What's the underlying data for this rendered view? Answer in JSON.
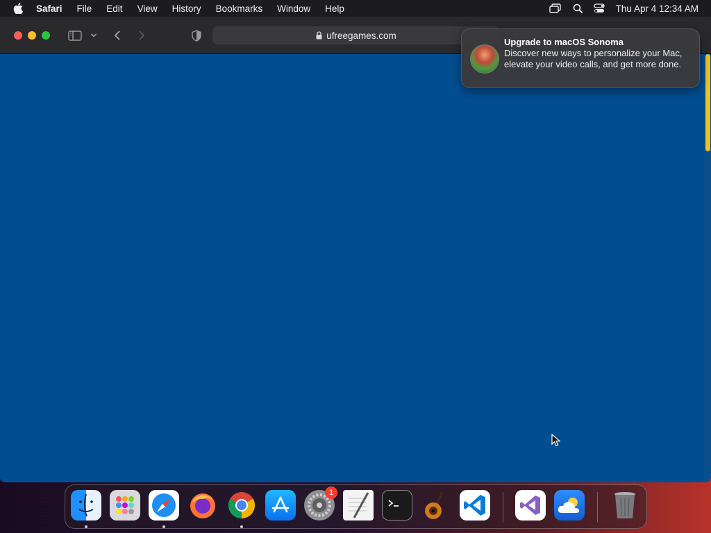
{
  "menubar": {
    "app_name": "Safari",
    "items": [
      "File",
      "Edit",
      "View",
      "History",
      "Bookmarks",
      "Window",
      "Help"
    ],
    "clock": "Thu Apr 4  12:34 AM"
  },
  "browser": {
    "url": "ufreegames.com",
    "page_background": "#004e92",
    "scrollbar_color": "#f3c21a"
  },
  "notification": {
    "title": "Upgrade to macOS Sonoma",
    "body": "Discover new ways to personalize your Mac, elevate your video calls, and get more done."
  },
  "dock": {
    "apps": [
      {
        "name": "Finder",
        "icon": "finder-icon",
        "running": true
      },
      {
        "name": "Launchpad",
        "icon": "launchpad-icon",
        "running": false
      },
      {
        "name": "Safari",
        "icon": "safari-icon",
        "running": true
      },
      {
        "name": "Firefox",
        "icon": "firefox-icon",
        "running": false
      },
      {
        "name": "Chrome",
        "icon": "chrome-icon",
        "running": true
      },
      {
        "name": "App Store",
        "icon": "app-store-icon",
        "running": false
      },
      {
        "name": "System Settings",
        "icon": "system-settings-icon",
        "running": false,
        "badge": "1"
      },
      {
        "name": "TextEdit",
        "icon": "textedit-icon",
        "running": false
      },
      {
        "name": "Terminal",
        "icon": "terminal-icon",
        "running": false
      },
      {
        "name": "GarageBand",
        "icon": "garageband-icon",
        "running": false
      },
      {
        "name": "Visual Studio Code",
        "icon": "vscode-icon",
        "running": false
      },
      {
        "name": "Visual Studio",
        "icon": "visual-studio-icon",
        "running": false
      },
      {
        "name": "Weather",
        "icon": "weather-icon",
        "running": false
      },
      {
        "name": "Trash",
        "icon": "trash-icon",
        "running": false
      }
    ]
  }
}
